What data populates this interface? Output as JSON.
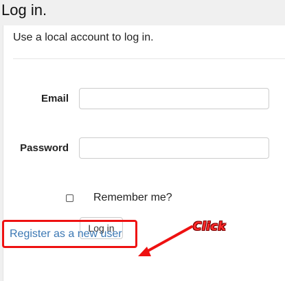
{
  "page": {
    "title": "Log in."
  },
  "form": {
    "subtitle": "Use a local account to log in.",
    "email_label": "Email",
    "email_value": "",
    "password_label": "Password",
    "password_value": "",
    "remember_label": "Remember me?",
    "remember_checked": false,
    "login_button_label": "Log in",
    "register_link_label": "Register as a new user"
  },
  "annotation": {
    "click_label": "Click",
    "color": "#ee1111"
  },
  "colors": {
    "link": "#3a77b3",
    "background": "#f0f0f0"
  }
}
